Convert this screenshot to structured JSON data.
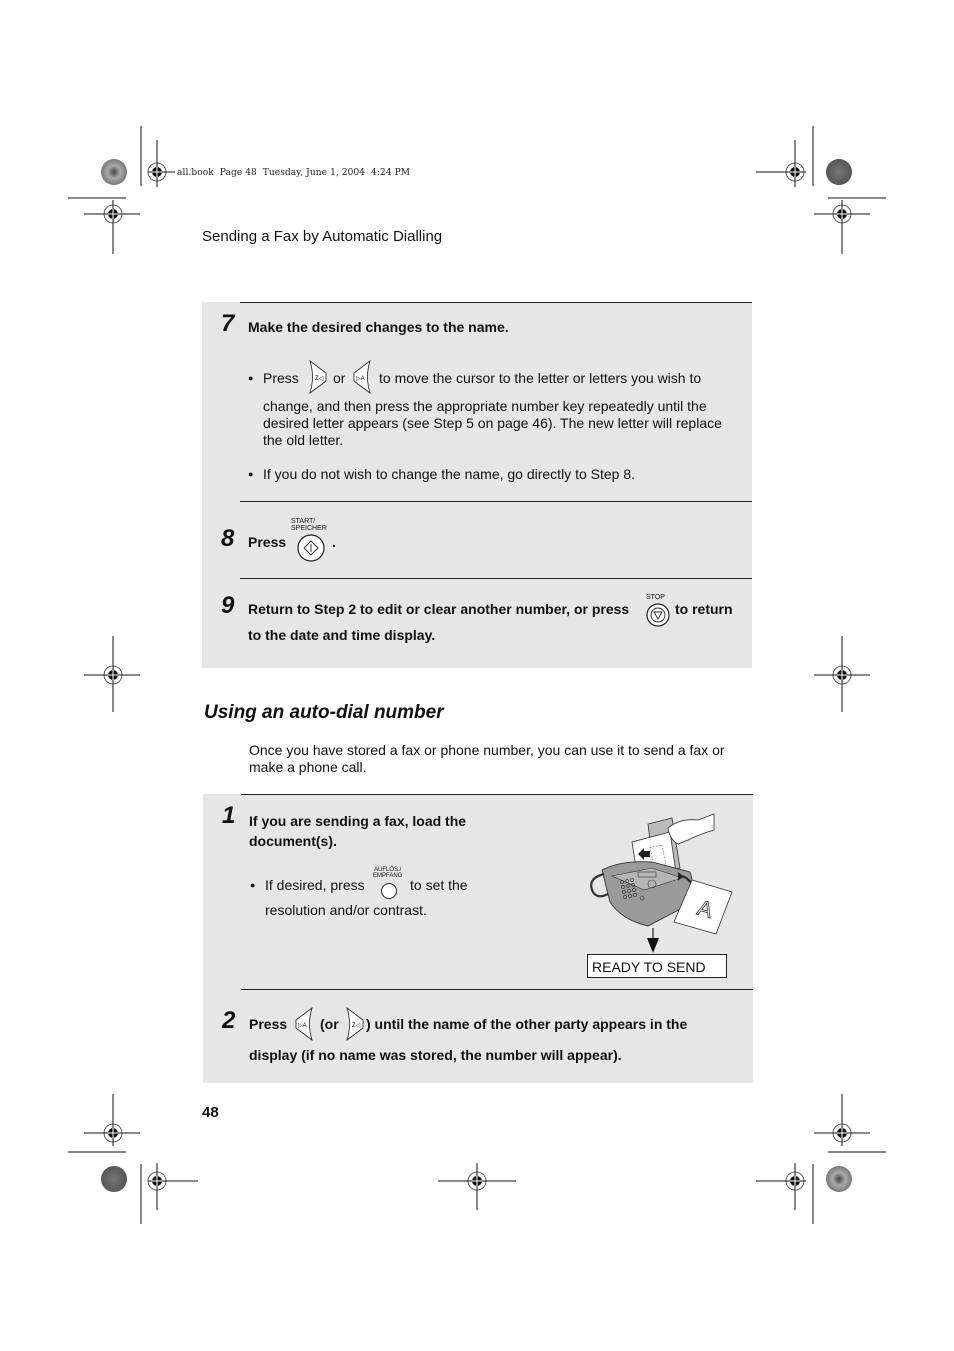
{
  "slug": "all.book  Page 48  Tuesday, June 1, 2004  4:24 PM",
  "running_head": "Sending a Fax by Automatic Dialling",
  "page_number": "48",
  "steps_top": [
    {
      "number": "7",
      "title": "Make the desired changes to the name.",
      "bullets": [
        {
          "pre": "Press",
          "key1": "right-arrow-key",
          "mid": "or",
          "key2": "left-arrow-key",
          "post": "to move the cursor to the letter or letters you wish to",
          "cont": "change, and then press the appropriate number key repeatedly until the desired letter appears (see Step 5 on page 46). The new letter will replace the old letter."
        },
        {
          "text": "If you do not wish to change the name, go directly to Step 8."
        }
      ]
    },
    {
      "number": "8",
      "pre": "Press",
      "key_label": "START/\nSPEICHER",
      "key_label_line1": "START/",
      "key_label_line2": "SPEICHER",
      "post": "."
    },
    {
      "number": "9",
      "pre": "Return to Step 2 to edit or clear another number, or press",
      "key_label": "STOP",
      "post": "to return",
      "cont": "to the date and time display."
    }
  ],
  "section": {
    "title": "Using an auto-dial number",
    "intro": "Once you have stored a fax or phone number, you can use it to send a fax or make a phone call."
  },
  "steps_bottom": [
    {
      "number": "1",
      "title_line1": "If you are sending a fax, load the",
      "title_line2": "document(s).",
      "bullet_pre": "If desired, press",
      "key_label_line1": "AUFLÖS./",
      "key_label_line2": "EMPFANG",
      "bullet_post": "to set the",
      "bullet_cont": "resolution and/or contrast.",
      "display_text": "READY TO SEND",
      "illustration_letter": "A"
    },
    {
      "number": "2",
      "pre": "Press",
      "mid": "(or",
      "post": ") until the name of the other party appears in the",
      "cont": "display (if no name was stored, the number will appear)."
    }
  ]
}
